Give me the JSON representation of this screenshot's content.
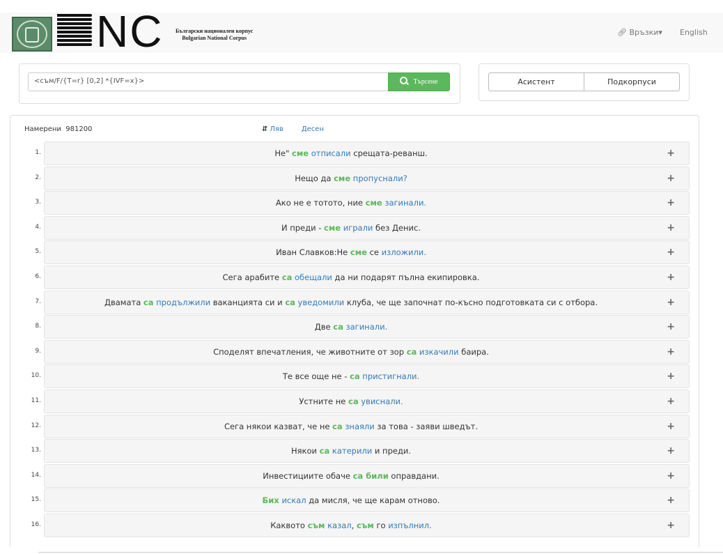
{
  "header": {
    "subtitle_bg": "Български национален корпус",
    "subtitle_en": "Bulgarian National Corpus",
    "links_menu": "Връзки",
    "language": "English"
  },
  "search": {
    "query": "<съм/F/{T=r} [0,2] *{IVF=x}>",
    "button": "Търсене"
  },
  "tools": {
    "assistant": "Асистент",
    "subcorpora": "Подкорпуси"
  },
  "results": {
    "found_label": "Намерени",
    "found_count": "981200",
    "sort_left": "Ляв",
    "sort_right": "Десен",
    "rows": [
      {
        "num": "1.",
        "parts": [
          [
            "Не\" ",
            ""
          ],
          [
            "сме",
            "k"
          ],
          [
            " ",
            ""
          ],
          [
            "отписали",
            "v"
          ],
          [
            " срещата-реванш.",
            ""
          ]
        ]
      },
      {
        "num": "2.",
        "parts": [
          [
            "Нещо да ",
            ""
          ],
          [
            "сме",
            "k"
          ],
          [
            " ",
            ""
          ],
          [
            "пропуснали?",
            "v"
          ]
        ]
      },
      {
        "num": "3.",
        "parts": [
          [
            "Ако не е тотото, ние ",
            ""
          ],
          [
            "сме",
            "k"
          ],
          [
            " ",
            ""
          ],
          [
            "загинали.",
            "v"
          ]
        ]
      },
      {
        "num": "4.",
        "parts": [
          [
            "И преди - ",
            ""
          ],
          [
            "сме",
            "k"
          ],
          [
            " ",
            ""
          ],
          [
            "играли",
            "v"
          ],
          [
            " без Денис.",
            ""
          ]
        ]
      },
      {
        "num": "5.",
        "parts": [
          [
            "Иван Славков:Не ",
            ""
          ],
          [
            "сме",
            "k"
          ],
          [
            " се ",
            ""
          ],
          [
            "изложили.",
            "v"
          ]
        ]
      },
      {
        "num": "6.",
        "parts": [
          [
            "Сега арабите ",
            ""
          ],
          [
            "са",
            "k"
          ],
          [
            " ",
            ""
          ],
          [
            "обещали",
            "v"
          ],
          [
            " да ни подарят пълна екипировка.",
            ""
          ]
        ]
      },
      {
        "num": "7.",
        "parts": [
          [
            "Двамата ",
            ""
          ],
          [
            "са",
            "k"
          ],
          [
            " ",
            ""
          ],
          [
            "продължили",
            "v"
          ],
          [
            " ваканцията си и ",
            ""
          ],
          [
            "са",
            "k"
          ],
          [
            " ",
            ""
          ],
          [
            "уведомили",
            "v"
          ],
          [
            " клуба, че ще започнат по-късно подготовката си с отбора.",
            ""
          ]
        ]
      },
      {
        "num": "8.",
        "parts": [
          [
            "Две ",
            ""
          ],
          [
            "са",
            "k"
          ],
          [
            " ",
            ""
          ],
          [
            "загинали.",
            "v"
          ]
        ]
      },
      {
        "num": "9.",
        "parts": [
          [
            "Споделят впечатления, че животните от зор ",
            ""
          ],
          [
            "са",
            "k"
          ],
          [
            " ",
            ""
          ],
          [
            "изкачили",
            "v"
          ],
          [
            " баира.",
            ""
          ]
        ]
      },
      {
        "num": "10.",
        "parts": [
          [
            "Те все още не - ",
            ""
          ],
          [
            "са",
            "k"
          ],
          [
            " ",
            ""
          ],
          [
            "пристигнали.",
            "v"
          ]
        ]
      },
      {
        "num": "11.",
        "parts": [
          [
            "Устните не ",
            ""
          ],
          [
            "са",
            "k"
          ],
          [
            " ",
            ""
          ],
          [
            "увиснали.",
            "v"
          ]
        ]
      },
      {
        "num": "12.",
        "parts": [
          [
            "Сега някои казват, че не ",
            ""
          ],
          [
            "са",
            "k"
          ],
          [
            " ",
            ""
          ],
          [
            "знаяли",
            "v"
          ],
          [
            " за това - заяви шведът.",
            ""
          ]
        ]
      },
      {
        "num": "13.",
        "parts": [
          [
            "Някои ",
            ""
          ],
          [
            "са",
            "k"
          ],
          [
            " ",
            ""
          ],
          [
            "катерили",
            "v"
          ],
          [
            " и преди.",
            ""
          ]
        ]
      },
      {
        "num": "14.",
        "parts": [
          [
            "Инвестициите обаче ",
            ""
          ],
          [
            "са били",
            "k"
          ],
          [
            " оправдани.",
            ""
          ]
        ]
      },
      {
        "num": "15.",
        "parts": [
          [
            "Бих",
            "k"
          ],
          [
            " ",
            ""
          ],
          [
            "искал",
            "v"
          ],
          [
            " да мисля, че ще карам отново.",
            ""
          ]
        ]
      },
      {
        "num": "16.",
        "parts": [
          [
            "Каквото ",
            ""
          ],
          [
            "съм",
            "k"
          ],
          [
            " ",
            ""
          ],
          [
            "казал",
            "v"
          ],
          [
            ", ",
            ""
          ],
          [
            "съм",
            "k"
          ],
          [
            " го ",
            ""
          ],
          [
            "изпълнил.",
            "v"
          ]
        ]
      }
    ]
  }
}
